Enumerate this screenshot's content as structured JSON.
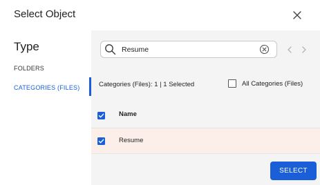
{
  "dialog": {
    "title": "Select Object",
    "close_icon": "close-icon"
  },
  "sidebar": {
    "heading": "Type",
    "items": [
      {
        "label": "FOLDERS",
        "active": false
      },
      {
        "label": "CATEGORIES (FILES)",
        "active": true
      }
    ],
    "accent_color": "#1a5fd8"
  },
  "search": {
    "value": "Resume",
    "placeholder": "",
    "icon": "search-icon",
    "clear_icon": "clear-icon"
  },
  "pagination": {
    "prev_icon": "chevron-left-icon",
    "next_icon": "chevron-right-icon"
  },
  "filters": {
    "summary": "Categories (Files): 1 | 1 Selected",
    "all_categories_label": "All Categories (Files)",
    "all_categories_checked": false
  },
  "table": {
    "header_checked": true,
    "columns": [
      "Name"
    ],
    "rows": [
      {
        "name": "Resume",
        "checked": true,
        "highlight_color": "#fcefe9"
      }
    ]
  },
  "footer": {
    "select_label": "SELECT",
    "select_color": "#1a5fd8"
  }
}
